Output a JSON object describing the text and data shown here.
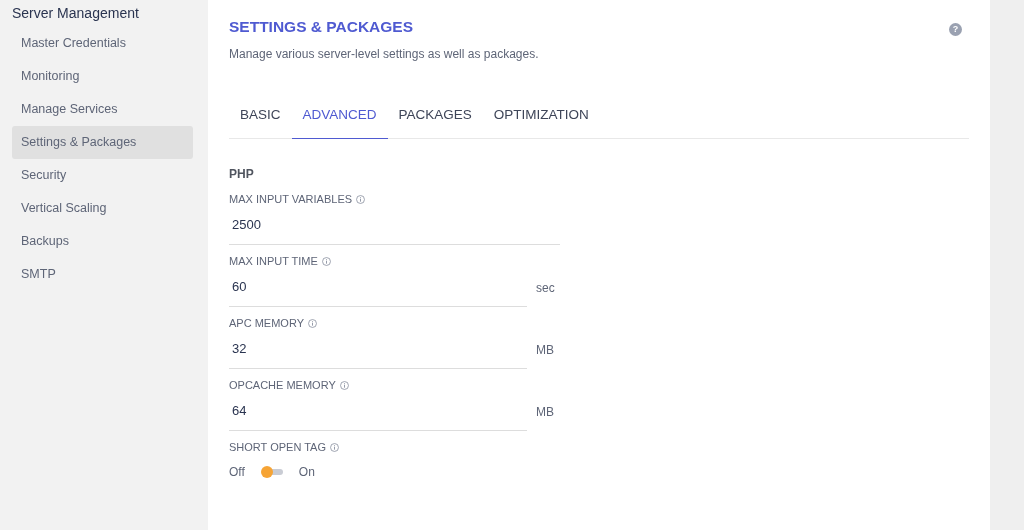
{
  "sidebar": {
    "title": "Server Management",
    "items": [
      {
        "label": "Master Credentials",
        "selected": false
      },
      {
        "label": "Monitoring",
        "selected": false
      },
      {
        "label": "Manage Services",
        "selected": false
      },
      {
        "label": "Settings & Packages",
        "selected": true
      },
      {
        "label": "Security",
        "selected": false
      },
      {
        "label": "Vertical Scaling",
        "selected": false
      },
      {
        "label": "Backups",
        "selected": false
      },
      {
        "label": "SMTP",
        "selected": false
      }
    ]
  },
  "header": {
    "title": "SETTINGS & PACKAGES",
    "subtitle": "Manage various server-level settings as well as packages.",
    "help": "?"
  },
  "tabs": [
    {
      "label": "BASIC",
      "selected": false
    },
    {
      "label": "ADVANCED",
      "selected": true
    },
    {
      "label": "PACKAGES",
      "selected": false
    },
    {
      "label": "OPTIMIZATION",
      "selected": false
    }
  ],
  "section": "PHP",
  "fields": [
    {
      "kind": "input",
      "label": "MAX INPUT VARIABLES",
      "value": "2500"
    },
    {
      "kind": "input",
      "label": "MAX INPUT TIME",
      "value": "60",
      "unit": "sec"
    },
    {
      "kind": "input",
      "label": "APC MEMORY",
      "value": "32",
      "unit": "MB"
    },
    {
      "kind": "input",
      "label": "OPCACHE MEMORY",
      "value": "64",
      "unit": "MB"
    },
    {
      "kind": "toggle",
      "label": "SHORT OPEN TAG",
      "off_label": "Off",
      "on_label": "On",
      "on": false
    }
  ]
}
